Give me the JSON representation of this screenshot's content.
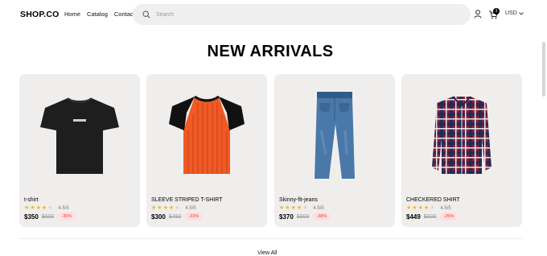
{
  "header": {
    "logo": "SHOP.CO",
    "nav": [
      "Home",
      "Catalog",
      "Contact"
    ],
    "search_placeholder": "Search",
    "cart_count": "3",
    "currency": "USD"
  },
  "section": {
    "title": "NEW ARRIVALS",
    "view_all": "View All"
  },
  "products": [
    {
      "name": "t-shirt",
      "rating": "4.5/5",
      "stars": 4.5,
      "price": "$350",
      "old_price": "$600",
      "discount": "-30%",
      "image": "black-tshirt"
    },
    {
      "name": "SLEEVE STRIPED T-SHIRT",
      "rating": "4.5/5",
      "stars": 4.5,
      "price": "$300",
      "old_price": "$450",
      "discount": "-33%",
      "image": "orange-striped-tshirt"
    },
    {
      "name": "Skinny-fit-jeans",
      "rating": "4.5/5",
      "stars": 4.5,
      "price": "$370",
      "old_price": "$600",
      "discount": "-38%",
      "image": "blue-jeans"
    },
    {
      "name": "CHECKERED SHIRT",
      "rating": "4.5/5",
      "stars": 4.5,
      "price": "$449",
      "old_price": "$600",
      "discount": "-25%",
      "image": "checkered-shirt"
    }
  ],
  "colors": {
    "card_bg": "#f0eeed",
    "star": "#f2b71a",
    "discount_text": "#ff3333",
    "discount_bg": "#fde0e0"
  }
}
